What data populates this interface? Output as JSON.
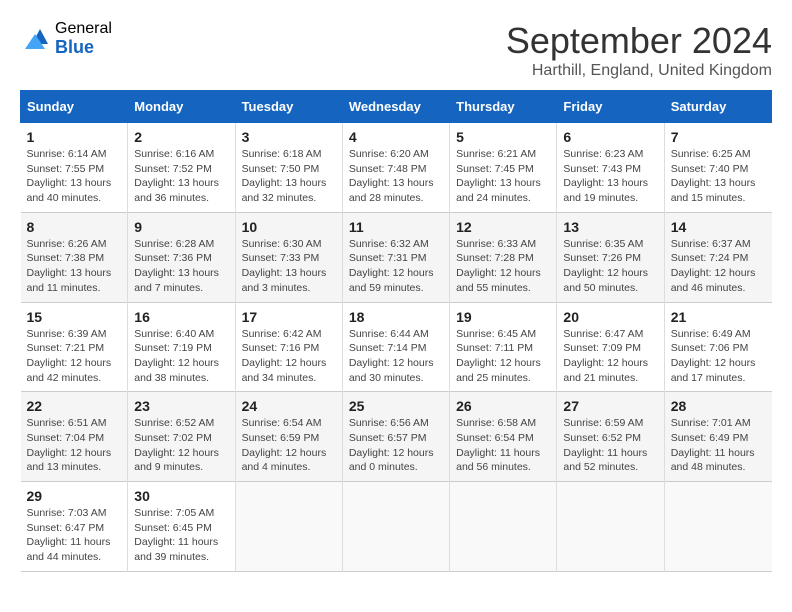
{
  "logo": {
    "general": "General",
    "blue": "Blue"
  },
  "title": "September 2024",
  "location": "Harthill, England, United Kingdom",
  "days_of_week": [
    "Sunday",
    "Monday",
    "Tuesday",
    "Wednesday",
    "Thursday",
    "Friday",
    "Saturday"
  ],
  "weeks": [
    [
      {
        "day": "1",
        "sunrise": "Sunrise: 6:14 AM",
        "sunset": "Sunset: 7:55 PM",
        "daylight": "Daylight: 13 hours and 40 minutes."
      },
      {
        "day": "2",
        "sunrise": "Sunrise: 6:16 AM",
        "sunset": "Sunset: 7:52 PM",
        "daylight": "Daylight: 13 hours and 36 minutes."
      },
      {
        "day": "3",
        "sunrise": "Sunrise: 6:18 AM",
        "sunset": "Sunset: 7:50 PM",
        "daylight": "Daylight: 13 hours and 32 minutes."
      },
      {
        "day": "4",
        "sunrise": "Sunrise: 6:20 AM",
        "sunset": "Sunset: 7:48 PM",
        "daylight": "Daylight: 13 hours and 28 minutes."
      },
      {
        "day": "5",
        "sunrise": "Sunrise: 6:21 AM",
        "sunset": "Sunset: 7:45 PM",
        "daylight": "Daylight: 13 hours and 24 minutes."
      },
      {
        "day": "6",
        "sunrise": "Sunrise: 6:23 AM",
        "sunset": "Sunset: 7:43 PM",
        "daylight": "Daylight: 13 hours and 19 minutes."
      },
      {
        "day": "7",
        "sunrise": "Sunrise: 6:25 AM",
        "sunset": "Sunset: 7:40 PM",
        "daylight": "Daylight: 13 hours and 15 minutes."
      }
    ],
    [
      {
        "day": "8",
        "sunrise": "Sunrise: 6:26 AM",
        "sunset": "Sunset: 7:38 PM",
        "daylight": "Daylight: 13 hours and 11 minutes."
      },
      {
        "day": "9",
        "sunrise": "Sunrise: 6:28 AM",
        "sunset": "Sunset: 7:36 PM",
        "daylight": "Daylight: 13 hours and 7 minutes."
      },
      {
        "day": "10",
        "sunrise": "Sunrise: 6:30 AM",
        "sunset": "Sunset: 7:33 PM",
        "daylight": "Daylight: 13 hours and 3 minutes."
      },
      {
        "day": "11",
        "sunrise": "Sunrise: 6:32 AM",
        "sunset": "Sunset: 7:31 PM",
        "daylight": "Daylight: 12 hours and 59 minutes."
      },
      {
        "day": "12",
        "sunrise": "Sunrise: 6:33 AM",
        "sunset": "Sunset: 7:28 PM",
        "daylight": "Daylight: 12 hours and 55 minutes."
      },
      {
        "day": "13",
        "sunrise": "Sunrise: 6:35 AM",
        "sunset": "Sunset: 7:26 PM",
        "daylight": "Daylight: 12 hours and 50 minutes."
      },
      {
        "day": "14",
        "sunrise": "Sunrise: 6:37 AM",
        "sunset": "Sunset: 7:24 PM",
        "daylight": "Daylight: 12 hours and 46 minutes."
      }
    ],
    [
      {
        "day": "15",
        "sunrise": "Sunrise: 6:39 AM",
        "sunset": "Sunset: 7:21 PM",
        "daylight": "Daylight: 12 hours and 42 minutes."
      },
      {
        "day": "16",
        "sunrise": "Sunrise: 6:40 AM",
        "sunset": "Sunset: 7:19 PM",
        "daylight": "Daylight: 12 hours and 38 minutes."
      },
      {
        "day": "17",
        "sunrise": "Sunrise: 6:42 AM",
        "sunset": "Sunset: 7:16 PM",
        "daylight": "Daylight: 12 hours and 34 minutes."
      },
      {
        "day": "18",
        "sunrise": "Sunrise: 6:44 AM",
        "sunset": "Sunset: 7:14 PM",
        "daylight": "Daylight: 12 hours and 30 minutes."
      },
      {
        "day": "19",
        "sunrise": "Sunrise: 6:45 AM",
        "sunset": "Sunset: 7:11 PM",
        "daylight": "Daylight: 12 hours and 25 minutes."
      },
      {
        "day": "20",
        "sunrise": "Sunrise: 6:47 AM",
        "sunset": "Sunset: 7:09 PM",
        "daylight": "Daylight: 12 hours and 21 minutes."
      },
      {
        "day": "21",
        "sunrise": "Sunrise: 6:49 AM",
        "sunset": "Sunset: 7:06 PM",
        "daylight": "Daylight: 12 hours and 17 minutes."
      }
    ],
    [
      {
        "day": "22",
        "sunrise": "Sunrise: 6:51 AM",
        "sunset": "Sunset: 7:04 PM",
        "daylight": "Daylight: 12 hours and 13 minutes."
      },
      {
        "day": "23",
        "sunrise": "Sunrise: 6:52 AM",
        "sunset": "Sunset: 7:02 PM",
        "daylight": "Daylight: 12 hours and 9 minutes."
      },
      {
        "day": "24",
        "sunrise": "Sunrise: 6:54 AM",
        "sunset": "Sunset: 6:59 PM",
        "daylight": "Daylight: 12 hours and 4 minutes."
      },
      {
        "day": "25",
        "sunrise": "Sunrise: 6:56 AM",
        "sunset": "Sunset: 6:57 PM",
        "daylight": "Daylight: 12 hours and 0 minutes."
      },
      {
        "day": "26",
        "sunrise": "Sunrise: 6:58 AM",
        "sunset": "Sunset: 6:54 PM",
        "daylight": "Daylight: 11 hours and 56 minutes."
      },
      {
        "day": "27",
        "sunrise": "Sunrise: 6:59 AM",
        "sunset": "Sunset: 6:52 PM",
        "daylight": "Daylight: 11 hours and 52 minutes."
      },
      {
        "day": "28",
        "sunrise": "Sunrise: 7:01 AM",
        "sunset": "Sunset: 6:49 PM",
        "daylight": "Daylight: 11 hours and 48 minutes."
      }
    ],
    [
      {
        "day": "29",
        "sunrise": "Sunrise: 7:03 AM",
        "sunset": "Sunset: 6:47 PM",
        "daylight": "Daylight: 11 hours and 44 minutes."
      },
      {
        "day": "30",
        "sunrise": "Sunrise: 7:05 AM",
        "sunset": "Sunset: 6:45 PM",
        "daylight": "Daylight: 11 hours and 39 minutes."
      },
      null,
      null,
      null,
      null,
      null
    ]
  ]
}
